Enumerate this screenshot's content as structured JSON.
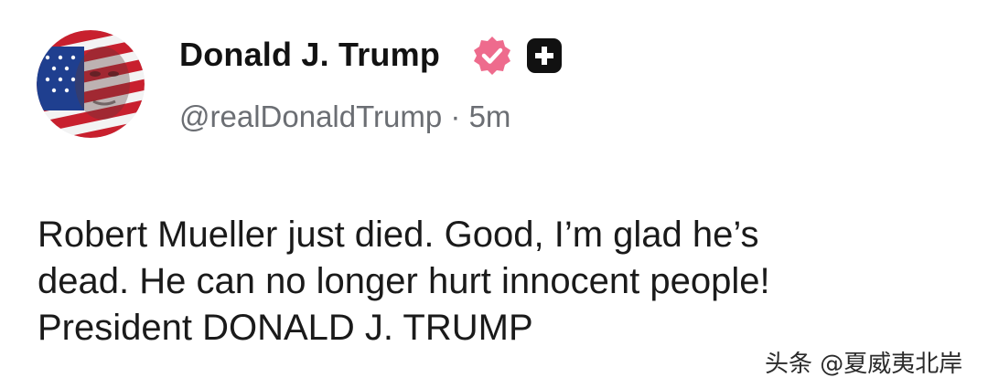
{
  "author": {
    "display_name": "Donald J. Trump",
    "handle": "@realDonaldTrump",
    "separator": "·",
    "timestamp": "5m",
    "avatar_icon": "profile-avatar-flag-portrait",
    "verified_icon": "verified-badge-icon",
    "affiliation_icon": "affiliation-badge-icon"
  },
  "post": {
    "lines": [
      "Robert Mueller just died. Good, I’m glad he’s",
      "dead. He can no longer hurt innocent people!",
      "President DONALD J. TRUMP"
    ]
  },
  "watermark": {
    "text": "头条 @夏威夷北岸"
  },
  "colors": {
    "verified_badge": "#ee6b8d",
    "affiliation_badge": "#111111",
    "handle_text": "#6b6e73",
    "body_text": "#1a1a1a"
  }
}
